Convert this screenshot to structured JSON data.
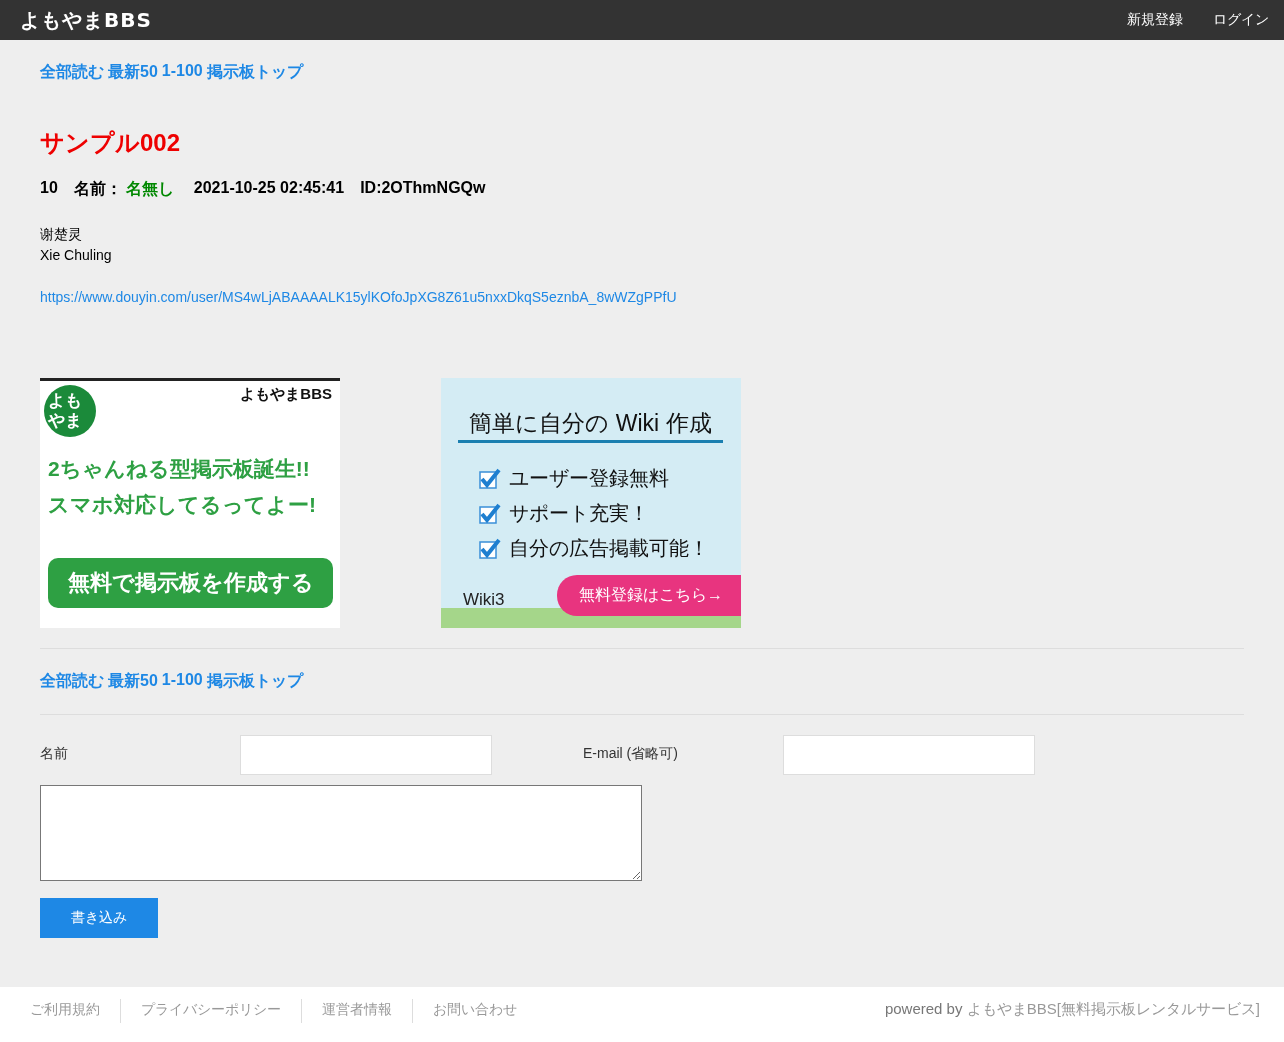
{
  "header": {
    "logo": "よもやまBBS",
    "links": [
      "新規登録",
      "ログイン"
    ]
  },
  "nav_top": [
    "全部読む",
    "最新50",
    "1-100",
    "掲示板トップ"
  ],
  "thread_title": "サンプル002",
  "post": {
    "number": "10",
    "name_label": "名前：",
    "name": "名無し",
    "date": "2021-10-25 02:45:41",
    "id": "ID:2OThmNGQw",
    "lines": [
      "谢楚灵",
      "Xie Chuling"
    ],
    "link": "https://www.douyin.com/user/MS4wLjABAAAALK15ylKOfoJpXG8Z61u5nxxDkqS5eznbA_8wWZgPPfU"
  },
  "banners": [
    {
      "kind": "bbs",
      "badge": [
        "よも",
        "やま"
      ],
      "logo": "よもやまBBS",
      "lines": [
        "2ちゃんねる型掲示板誕生!!",
        "スマホ対応してるってよー!"
      ],
      "button": "無料で掲示板を作成する"
    },
    {
      "kind": "wiki",
      "title": "簡単に自分の Wiki 作成",
      "items": [
        "ユーザー登録無料",
        "サポート充実！",
        "自分の広告掲載可能！"
      ],
      "brand": "Wiki3",
      "button": "無料登録はこちら→"
    }
  ],
  "nav_bottom": [
    "全部読む",
    "最新50",
    "1-100",
    "掲示板トップ"
  ],
  "form": {
    "name_label": "名前",
    "email_label": "E-mail (省略可)",
    "submit": "書き込み"
  },
  "footer": {
    "links": [
      "ご利用規約",
      "プライバシーポリシー",
      "運営者情報",
      "お問い合わせ"
    ],
    "powered_prefix": "powered by",
    "powered_link": "よもやまBBS[無料掲示板レンタルサービス]"
  }
}
